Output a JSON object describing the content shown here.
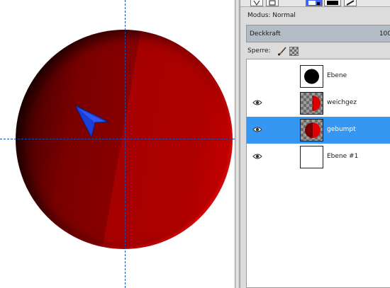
{
  "canvas": {
    "circle_color": "#a60000",
    "guide_color": "#1b4fae",
    "pointer_icon": "arrow-pointer-icon",
    "pointer_color": "#1a3fd6"
  },
  "tool_tabs": [
    "move-tool-icon",
    "paths-tool-icon",
    "layers-tool-icon",
    "gradient-tool-icon",
    "brush-tool-icon"
  ],
  "mode": {
    "label": "Modus:",
    "value": "Normal"
  },
  "opacity": {
    "label": "Deckkraft",
    "value": "100"
  },
  "lock": {
    "label": "Sperre:",
    "icons": [
      "lock-pixels-icon",
      "lock-alpha-icon"
    ]
  },
  "layers": [
    {
      "name": "Ebene",
      "visible": false,
      "selected": false,
      "thumb": "black-circle"
    },
    {
      "name": "weichgez",
      "visible": true,
      "selected": false,
      "thumb": "red-half-circle"
    },
    {
      "name": "gebumpt",
      "visible": true,
      "selected": true,
      "thumb": "red-half-circle"
    },
    {
      "name": "Ebene #1",
      "visible": true,
      "selected": false,
      "thumb": "white"
    }
  ],
  "colors": {
    "selection": "#3597f2",
    "panel": "#dcdcdc",
    "opacity_bar": "#b3bcc5"
  }
}
